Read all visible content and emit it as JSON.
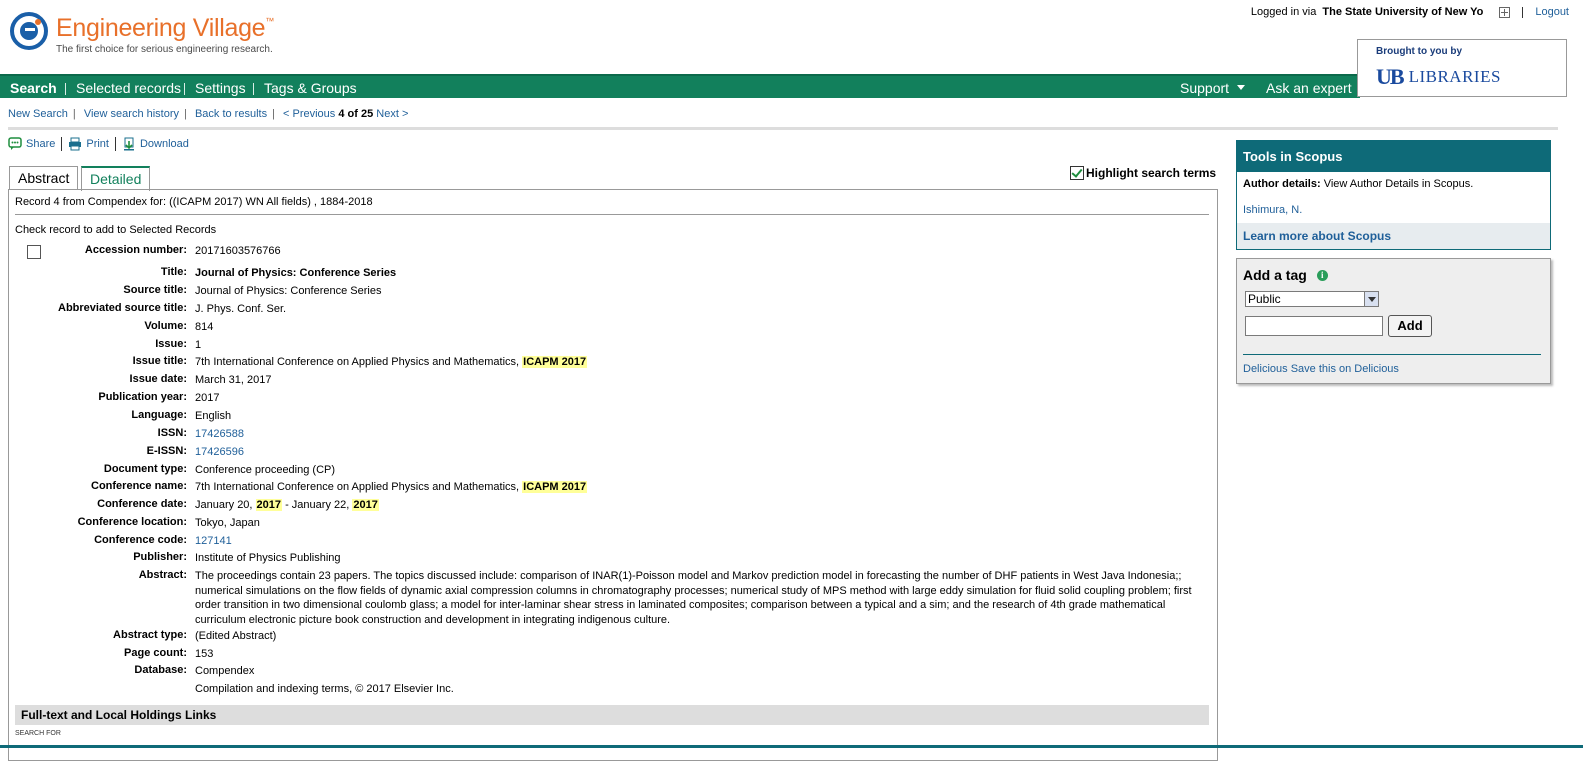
{
  "header": {
    "app_title": "Engineering Village",
    "trademark": "™",
    "tagline": "The first choice for serious engineering research.",
    "logged_in_prefix": "Logged in via",
    "institution": "The State University of New Yo",
    "logout": "Logout"
  },
  "nav": {
    "items": [
      "Search",
      "Selected records",
      "Settings",
      "Tags & Groups"
    ],
    "support": "Support",
    "ask_expert": "Ask an expert"
  },
  "libraries": {
    "brought_by": "Brought to you by",
    "logo_mark": "UB",
    "logo_word": "LIBRARIES"
  },
  "breadcrumbs": {
    "new_search": "New Search",
    "history": "View search history",
    "back": "Back to results",
    "previous": "< Previous",
    "position": "4 of 25",
    "next": "Next >"
  },
  "actions": {
    "share": "Share",
    "print": "Print",
    "download": "Download"
  },
  "tabs": {
    "abstract": "Abstract",
    "detailed": "Detailed"
  },
  "highlight": {
    "label": "Highlight search terms",
    "checked": true
  },
  "record": {
    "record_from": "Record 4 from Compendex for: ((ICAPM 2017) WN All fields) , 1884-2018",
    "check_note": "Check record to add to Selected Records",
    "fields": {
      "accession": {
        "label": "Accession number:",
        "value": "20171603576766"
      },
      "title": {
        "label": "Title:",
        "value": "Journal of Physics: Conference Series"
      },
      "source_title": {
        "label": "Source title:",
        "value": "Journal of Physics: Conference Series"
      },
      "abbr_source": {
        "label": "Abbreviated source title:",
        "value": "J. Phys. Conf. Ser."
      },
      "volume": {
        "label": "Volume:",
        "value": "814"
      },
      "issue": {
        "label": "Issue:",
        "value": "1"
      },
      "issue_title": {
        "label": "Issue title:",
        "value": "7th International Conference on Applied Physics and Mathematics, ",
        "highlight": "ICAPM 2017"
      },
      "issue_date": {
        "label": "Issue date:",
        "value": "March 31, 2017"
      },
      "pub_year": {
        "label": "Publication year:",
        "value": "2017"
      },
      "language": {
        "label": "Language:",
        "value": "English"
      },
      "issn": {
        "label": "ISSN:",
        "value": "17426588"
      },
      "eissn": {
        "label": "E-ISSN:",
        "value": "17426596"
      },
      "doc_type": {
        "label": "Document type:",
        "value": "Conference proceeding (CP)"
      },
      "conf_name": {
        "label": "Conference name:",
        "value": "7th International Conference on Applied Physics and Mathematics, ",
        "highlight": "ICAPM 2017"
      },
      "conf_date": {
        "label": "Conference date:",
        "part1": "January 20, ",
        "hl1": "2017",
        "part2": " - January 22, ",
        "hl2": "2017"
      },
      "conf_location": {
        "label": "Conference location:",
        "value": "Tokyo, Japan"
      },
      "conf_code": {
        "label": "Conference code:",
        "value": "127141"
      },
      "publisher": {
        "label": "Publisher:",
        "value": "Institute of Physics Publishing"
      },
      "abstract": {
        "label": "Abstract:",
        "value": "The proceedings contain 23 papers. The topics discussed include: comparison of INAR(1)-Poisson model and Markov prediction model in forecasting the number of DHF patients in West Java Indonesia;; numerical simulations on the flow fields of dynamic axial compression columns in chromatography processes; numerical study of MPS method with large eddy simulation for fluid solid coupling problem; first order transition in two dimensional coulomb glass; a model for inter-laminar shear stress in laminated composites; comparison between a typical and a sim; and the research of 4th grade mathematical curriculum electronic picture book construction and development in integrating indigenous culture."
      },
      "abstract_type": {
        "label": "Abstract type:",
        "value": "(Edited Abstract)"
      },
      "page_count": {
        "label": "Page count:",
        "value": "153"
      },
      "database": {
        "label": "Database:",
        "value": "Compendex"
      },
      "copyright": {
        "value": "Compilation and indexing terms, © 2017 Elsevier Inc."
      }
    },
    "fulltext_heading": "Full-text and Local Holdings Links",
    "search_for": "SEARCH FOR"
  },
  "scopus": {
    "title": "Tools in Scopus",
    "author_label": "Author details:",
    "author_text": "View Author Details in Scopus.",
    "author_name": "Ishimura, N.",
    "learn_more": "Learn more about Scopus"
  },
  "tags": {
    "title": "Add a tag",
    "info_glyph": "i",
    "select_value": "Public",
    "add_button": "Add",
    "delicious": "Delicious",
    "delicious_save": "Save this on Delicious"
  },
  "colors": {
    "nav_green": "#12805c",
    "scopus_teal": "#0e6a78",
    "logo_orange": "#e8702a",
    "highlight": "#ffff99"
  }
}
